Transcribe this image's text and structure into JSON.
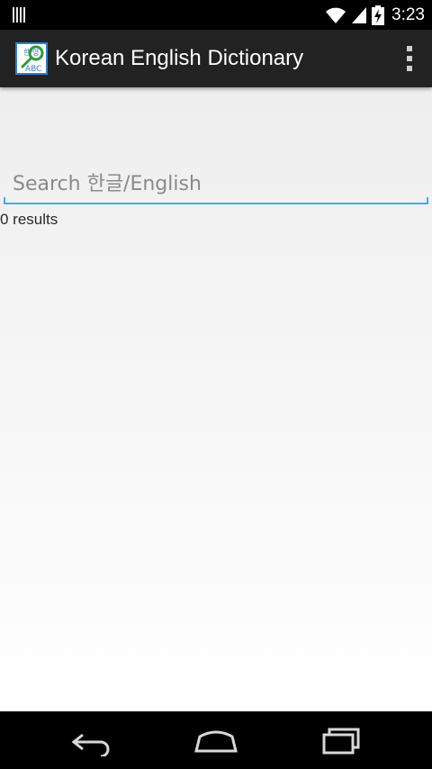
{
  "status_bar": {
    "time": "3:23",
    "icons": [
      "notification-icon",
      "wifi-icon",
      "signal-icon",
      "battery-charging-icon"
    ]
  },
  "action_bar": {
    "title": "Korean English Dictionary",
    "app_icon": "dictionary-app-icon",
    "app_icon_text": {
      "korean": "한/영",
      "latin": "ABC"
    },
    "overflow_icon": "overflow-menu-icon",
    "background_color": "#222222"
  },
  "search": {
    "placeholder": "Search 한글/English",
    "value": "",
    "accent_color": "#33b5e5"
  },
  "results": {
    "count_label": "0 results"
  },
  "nav_bar": {
    "buttons": [
      "back-icon",
      "home-icon",
      "recents-icon"
    ]
  }
}
